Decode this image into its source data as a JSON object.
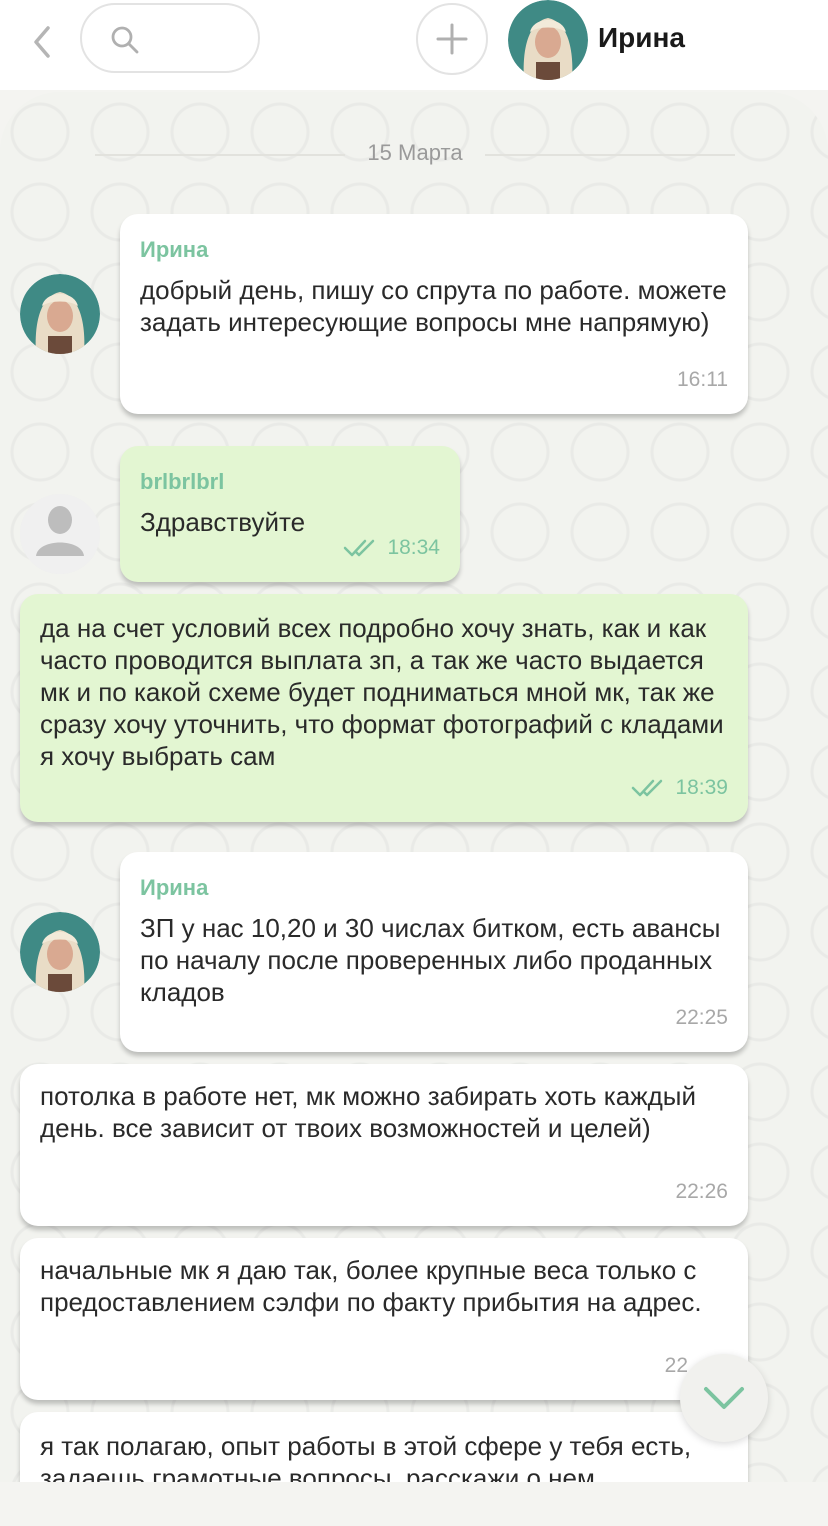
{
  "header": {
    "back_icon": "chevron-left-icon",
    "search_placeholder": "",
    "add_icon": "plus-icon",
    "contact_name": "Ирина"
  },
  "date_separator": "15 Марта",
  "messages": [
    {
      "sender": "Ирина",
      "text": "добрый день, пишу со спрута по работе. можете задать интересующие вопросы мне напрямую)",
      "time": "16:11",
      "outgoing": false
    },
    {
      "sender": "brlbrlbrl",
      "text": "Здравствуйте",
      "time": "18:34",
      "outgoing": true,
      "read": true
    },
    {
      "sender": "",
      "text": "да на счет условий всех подробно хочу знать, как и как часто проводится выплата зп, а так же часто выдается мк и по какой схеме будет подниматься мной мк, так же сразу хочу уточнить, что формат фотографий с кладами я хочу выбрать сам",
      "time": "18:39",
      "outgoing": true,
      "read": true
    },
    {
      "sender": "Ирина",
      "text": "ЗП у нас 10,20 и 30 числах битком, есть авансы по началу после проверенных либо проданных кладов",
      "time": "22:25",
      "outgoing": false
    },
    {
      "sender": "",
      "text": "потолка в работе нет, мк можно забирать хоть каждый день. все зависит от твоих возможностей и целей)",
      "time": "22:26",
      "outgoing": false
    },
    {
      "sender": "",
      "text": "начальные мк я даю так, более крупные веса только с предоставлением сэлфи по факту прибытия на адрес.",
      "time": "22",
      "outgoing": false
    },
    {
      "sender": "",
      "text": "я так полагаю, опыт работы в этой сфере у тебя есть, задаешь грамотные вопросы, расскажи о нем",
      "time": "",
      "outgoing": false
    }
  ],
  "colors": {
    "incoming_bubble": "#ffffff",
    "outgoing_bubble": "#e3f6d2",
    "accent_green": "#7cc4a0",
    "background": "#f2f3ef"
  },
  "scroll_button_icon": "chevron-down-icon"
}
